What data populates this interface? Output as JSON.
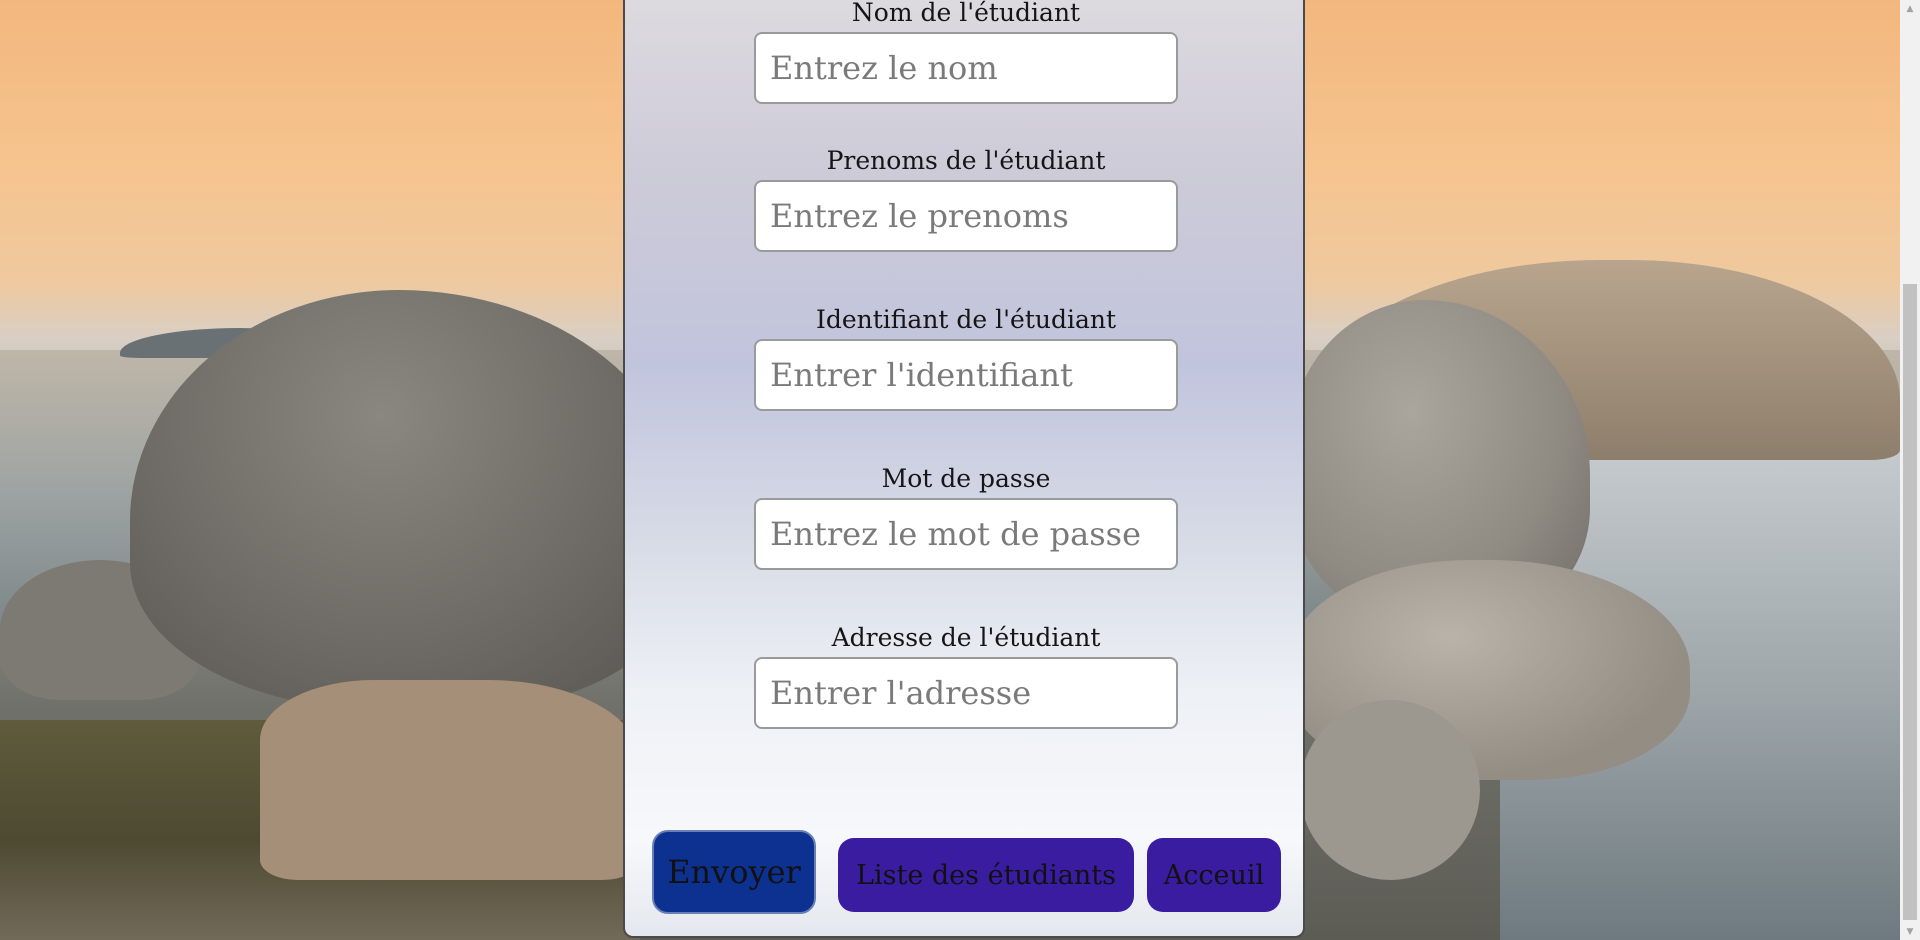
{
  "form": {
    "fields": [
      {
        "label": "Nom de l'étudiant",
        "placeholder": "Entrez le nom"
      },
      {
        "label": "Prenoms de l'étudiant",
        "placeholder": "Entrez le prenoms"
      },
      {
        "label": "Identifiant de l'étudiant",
        "placeholder": "Entrer l'identifiant"
      },
      {
        "label": "Mot de passe",
        "placeholder": "Entrez le mot de passe"
      },
      {
        "label": "Adresse de l'étudiant",
        "placeholder": "Entrer l'adresse"
      }
    ],
    "buttons": {
      "send": "Envoyer",
      "list": "Liste des étudiants",
      "home": "Acceuil"
    }
  },
  "colors": {
    "send_button": "#0c3191",
    "nav_button": "#3a1ca1"
  },
  "scrollbar": {
    "up_icon": "triangle-up",
    "down_icon": "triangle-down"
  }
}
